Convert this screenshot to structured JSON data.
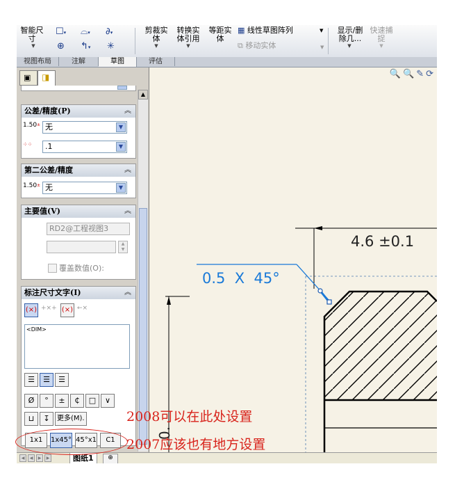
{
  "ribbon": {
    "smart_dimension": "智能尺寸",
    "trim": "剪裁实体",
    "convert": "转换实体引用",
    "offset": "等距实体",
    "linear_pattern": "线性草图阵列",
    "move_entities": "移动实体",
    "display_delete": "显示/删除几...",
    "quick_snap": "快速捕捉"
  },
  "tabs": [
    "视图布局",
    "注解",
    "草图",
    "评估"
  ],
  "panel": {
    "tolerance": {
      "title": "公差/精度(P)",
      "tol_icon": "1.50",
      "tol_value": "无",
      "precision_value": ".1"
    },
    "second_tolerance": {
      "title": "第二公差/精度",
      "tol_icon": "1.50",
      "tol_value": "无"
    },
    "primary_value": {
      "title": "主要值(V)",
      "ref_value": "RD2@工程视图3",
      "override_label": "覆盖数值(O):"
    },
    "dim_text": {
      "title": "标注尺寸文字(I)",
      "text": "<DIM>",
      "more_label": "更多(M)."
    }
  },
  "chamfer_buttons": [
    "1x1",
    "1x45°",
    "45°x1",
    "C1"
  ],
  "drawing": {
    "dim_linear": "4.6 ±0.1",
    "dim_chamfer": "0.5  X  45°",
    "dim_vertical": "0."
  },
  "sheet": {
    "tab_label": "图纸1"
  },
  "annotations": {
    "line1": "2008可以在此处设置",
    "line2": "2007应该也有地方设置"
  },
  "colors": {
    "annotation": "#d8241c",
    "dim_blue": "#1a7ad8"
  }
}
